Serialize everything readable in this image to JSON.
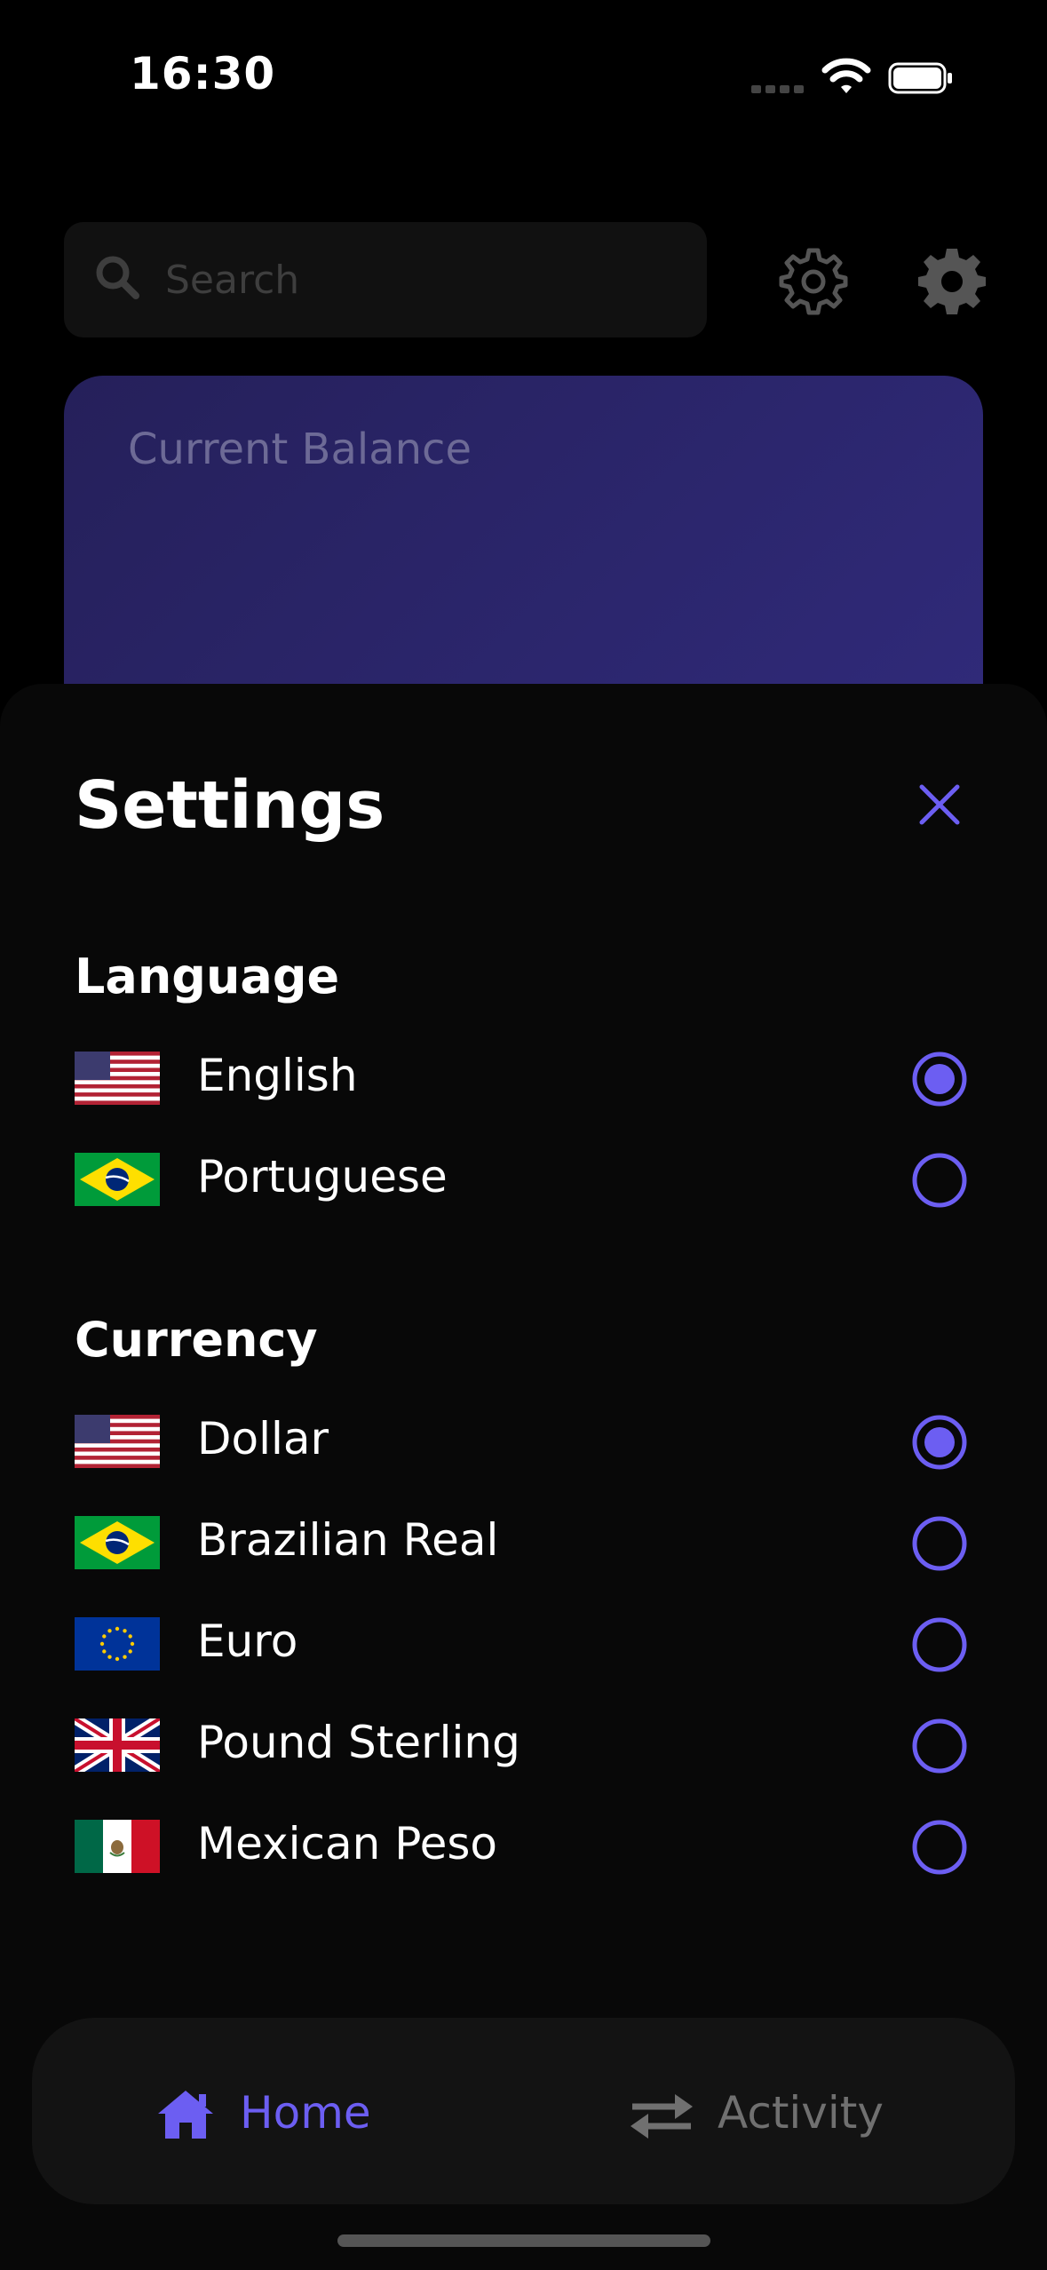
{
  "status_bar": {
    "time": "16:30"
  },
  "search": {
    "placeholder": "Search"
  },
  "balance": {
    "label": "Current Balance"
  },
  "sheet": {
    "title": "Settings",
    "language": {
      "heading": "Language",
      "options": [
        {
          "label": "English",
          "flag": "us-flag",
          "selected": true
        },
        {
          "label": "Portuguese",
          "flag": "brazil-flag",
          "selected": false
        }
      ]
    },
    "currency": {
      "heading": "Currency",
      "options": [
        {
          "label": "Dollar",
          "flag": "us-flag",
          "selected": true
        },
        {
          "label": "Brazilian Real",
          "flag": "brazil-flag",
          "selected": false
        },
        {
          "label": "Euro",
          "flag": "eu-flag",
          "selected": false
        },
        {
          "label": "Pound Sterling",
          "flag": "uk-flag",
          "selected": false
        },
        {
          "label": "Mexican Peso",
          "flag": "mexico-flag",
          "selected": false
        }
      ]
    }
  },
  "tabbar": {
    "home_label": "Home",
    "activity_label": "Activity"
  },
  "colors": {
    "accent": "#6c5ef2",
    "card_gradient_start": "#25205a",
    "card_gradient_end": "#302a7a",
    "sheet_bg": "#080808"
  }
}
